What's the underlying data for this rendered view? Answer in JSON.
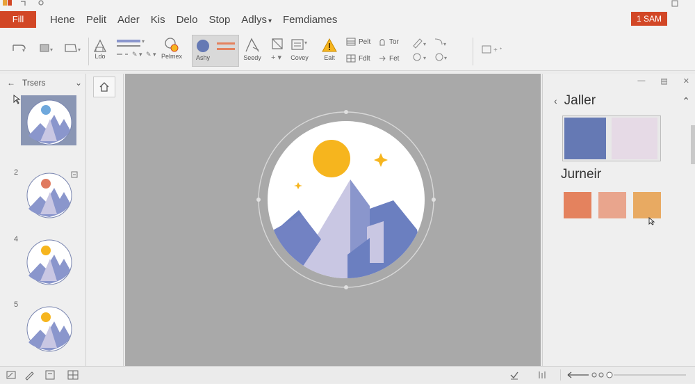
{
  "menubar": {
    "file_label": "Fill",
    "items": [
      {
        "label": "Hene"
      },
      {
        "label": "Pelit"
      },
      {
        "label": "Ader"
      },
      {
        "label": "Kis"
      },
      {
        "label": "Delo"
      },
      {
        "label": "Stop"
      },
      {
        "label": "Adlys",
        "has_dropdown": true
      },
      {
        "label": "Femdiames"
      }
    ],
    "time_badge": "1 SAM",
    "accent": "#d24726"
  },
  "ribbon": {
    "labels": {
      "lbl_ldo": "Ldo",
      "lbl_pelmex": "Pelmex",
      "lbl_ashy": "Ashy",
      "lbl_seedy": "Seedy",
      "lbl_covey": "Covey",
      "lbl_ealt": "Ealt",
      "lbl_pelt": "Pelt",
      "lbl_fdlt": "Fdlt",
      "lbl_tor": "Tor",
      "lbl_fet": "Fet"
    }
  },
  "left_panel": {
    "title": "Trsers",
    "slides": [
      {
        "num": "",
        "selected": true,
        "sun_color": "#6fa8dc"
      },
      {
        "num": "2",
        "selected": false,
        "sun_color": "#e07a5f"
      },
      {
        "num": "4",
        "selected": false,
        "sun_color": "#f6b51e"
      },
      {
        "num": "5",
        "selected": false,
        "sun_color": "#f6b51e"
      }
    ]
  },
  "canvas": {
    "sun_color": "#f6b51e",
    "mountain_colors": [
      "#6b7fc0",
      "#c9c7e3",
      "#8a96cc"
    ]
  },
  "right_panel": {
    "title": "Jaller",
    "subtitle": "Jurneir",
    "primary_swatches": [
      "#6579b4",
      "#e6dae6"
    ],
    "accent_swatches": [
      "#e4825e",
      "#e9a58d",
      "#e8aa62"
    ]
  },
  "icons": {
    "qat": [
      "app-logo-icon",
      "undo-icon",
      "settings-icon"
    ],
    "ribbon": [
      "undo-icon",
      "save-icon",
      "shape-icon",
      "image-icon",
      "line-weight-icon",
      "recolor-icon",
      "fill-circle-icon",
      "outline-lines-icon",
      "select-icon",
      "crop-icon",
      "layers-icon",
      "warning-icon",
      "grid-icon",
      "lock-icon",
      "pen-icon",
      "arrow-icon",
      "align-icon"
    ],
    "statusbar": [
      "notes-icon",
      "pen-icon",
      "slide-view-icon",
      "grid-view-icon",
      "check-icon",
      "fit-icon",
      "zoom-out-icon"
    ]
  }
}
